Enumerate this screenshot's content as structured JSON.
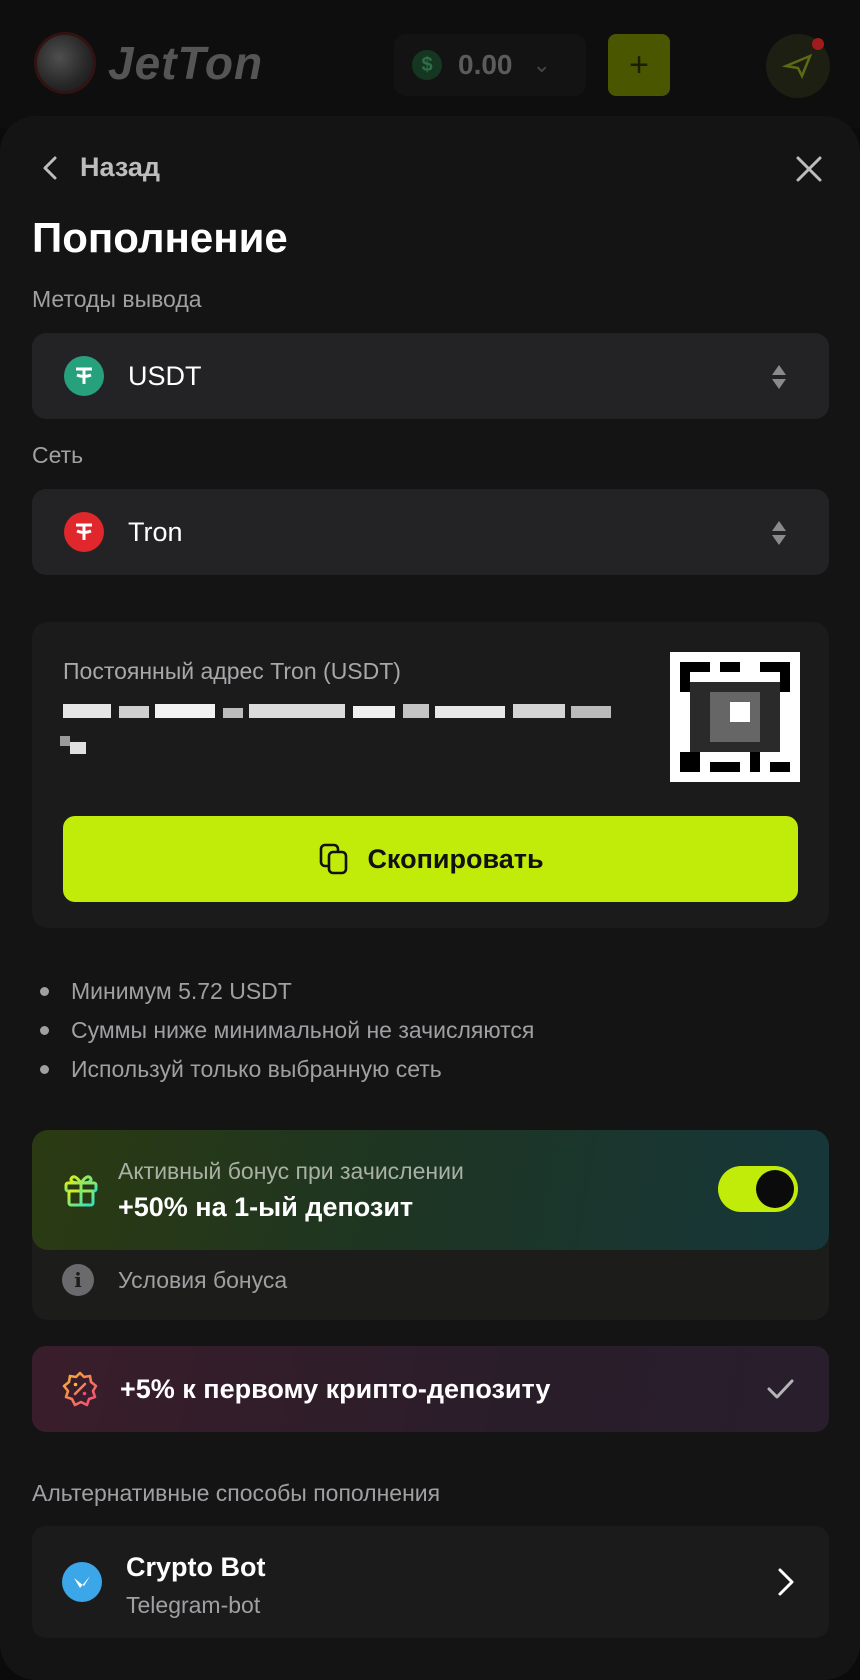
{
  "app": {
    "brand": "JetTon"
  },
  "header": {
    "balance": "0.00",
    "currency_symbol": "$",
    "deposit_button": "+"
  },
  "sheet": {
    "back_label": "Назад",
    "title": "Пополнение",
    "method_label": "Методы вывода",
    "method_value": "USDT",
    "network_label": "Сеть",
    "network_value": "Tron"
  },
  "address_card": {
    "title": "Постоянный адрес Tron (USDT)",
    "copy_label": "Скопировать"
  },
  "notes": [
    "Минимум 5.72 USDT",
    "Суммы ниже минимальной не зачисляются",
    "Используй только выбранную сеть"
  ],
  "bonus": {
    "subtitle": "Активный бонус при зачислении",
    "headline": "+50% на 1-ый депозит",
    "toggle_on": true,
    "conditions_label": "Условия бонуса"
  },
  "crypto_bonus": {
    "label": "+5% к первому крипто-депозиту",
    "selected": true
  },
  "alternatives": {
    "label": "Альтернативные способы пополнения",
    "items": [
      {
        "name": "Crypto Bot",
        "description": "Telegram-bot"
      }
    ]
  },
  "colors": {
    "accent": "#c1ec0a",
    "background": "#141415",
    "card": "#232325",
    "usdt": "#26a17b",
    "tron": "#e0272b"
  },
  "icons": {
    "back": "chevron-left-icon",
    "close": "close-icon",
    "usdt": "tether-icon",
    "tron": "tron-icon",
    "select": "updown-arrows-icon",
    "copy": "copy-icon",
    "gift": "gift-icon",
    "info": "info-icon",
    "percent": "percent-badge-icon",
    "check": "check-icon",
    "crypto_bot": "crypto-bot-icon",
    "chevron_right": "chevron-right-icon"
  }
}
